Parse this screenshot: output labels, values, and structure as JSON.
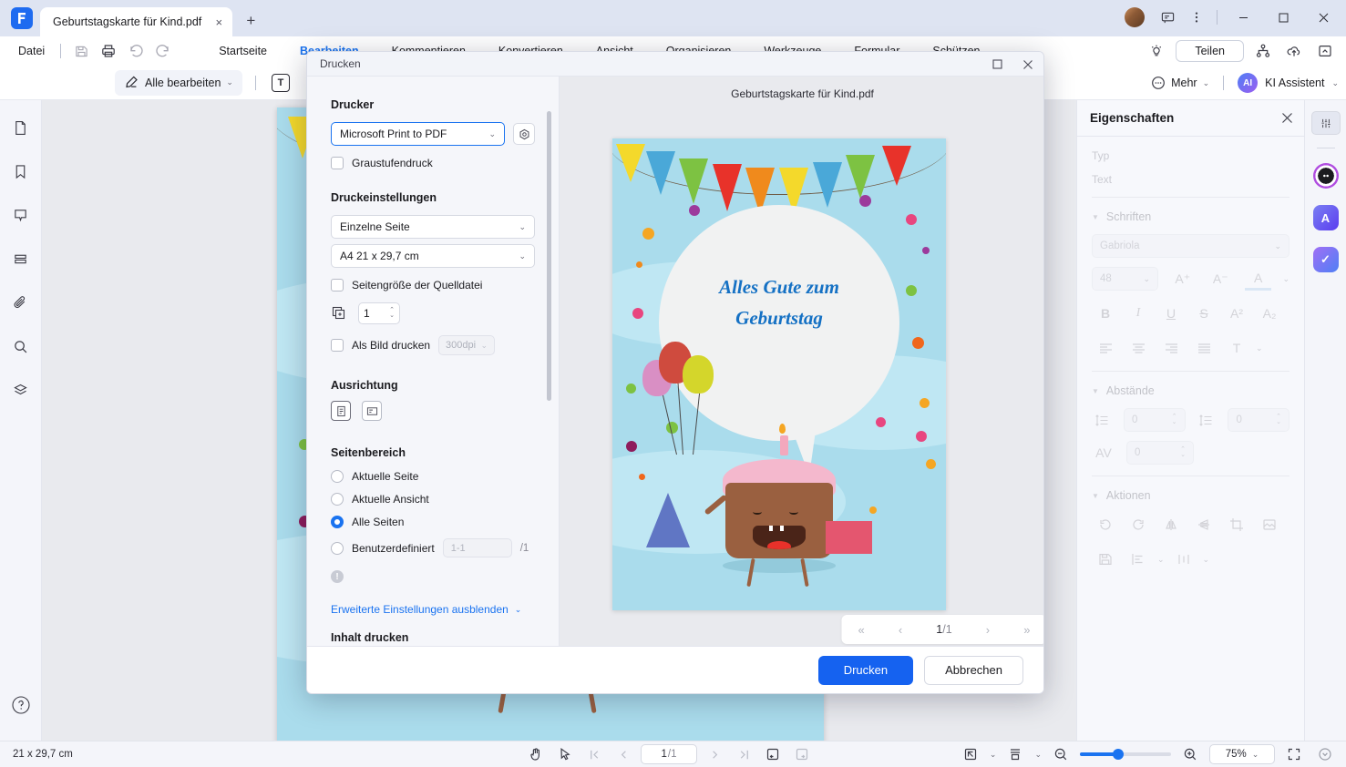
{
  "window": {
    "tab_title": "Geburtstagskarte für Kind.pdf",
    "close_tab": "×",
    "new_tab": "+",
    "minimize": "—",
    "maximize": "□",
    "close": "✕"
  },
  "menubar": {
    "file": "Datei",
    "tabs": [
      {
        "label": "Startseite",
        "active": false
      },
      {
        "label": "Bearbeiten",
        "active": true
      },
      {
        "label": "Kommentieren",
        "active": false
      },
      {
        "label": "Konvertieren",
        "active": false
      },
      {
        "label": "Ansicht",
        "active": false
      },
      {
        "label": "Organisieren",
        "active": false
      },
      {
        "label": "Werkzeuge",
        "active": false
      },
      {
        "label": "Formular",
        "active": false
      },
      {
        "label": "Schützen",
        "active": false
      }
    ],
    "share_label": "Teilen"
  },
  "toolbar": {
    "edit_all": "Alle bearbeiten",
    "text_tool": "T",
    "more": "Mehr",
    "ai_assistant": "KI Assistent",
    "ai_badge": "AI"
  },
  "left_rail": [
    {
      "name": "page-thumbnails-icon"
    },
    {
      "name": "bookmarks-icon"
    },
    {
      "name": "comments-icon"
    },
    {
      "name": "layers-list-icon"
    },
    {
      "name": "attachments-icon"
    },
    {
      "name": "search-icon"
    },
    {
      "name": "layers-icon"
    }
  ],
  "properties": {
    "title": "Eigenschaften",
    "type_label": "Typ",
    "type_value": "Text",
    "fonts_section": "Schriften",
    "font_family": "Gabriola",
    "font_size": "48",
    "spacing_section": "Abstände",
    "line_spacing": "0",
    "para_spacing": "0",
    "char_spacing": "0",
    "actions_section": "Aktionen"
  },
  "statusbar": {
    "page_size": "21 x 29,7 cm",
    "page_current": "1",
    "page_total": "/1",
    "zoom": "75%"
  },
  "dialog": {
    "title": "Drucken",
    "printer_section": "Drucker",
    "printer_value": "Microsoft Print to PDF",
    "grayscale_label": "Graustufendruck",
    "grayscale_checked": false,
    "settings_section": "Druckeinstellungen",
    "page_mode_value": "Einzelne Seite",
    "paper_size_value": "A4 21 x 29,7 cm",
    "source_size_label": "Seitengröße der Quelldatei",
    "source_size_checked": false,
    "copies_value": "1",
    "print_as_image_label": "Als Bild drucken",
    "print_as_image_checked": false,
    "dpi_value": "300dpi",
    "orientation_section": "Ausrichtung",
    "page_range_section": "Seitenbereich",
    "range_options": [
      {
        "label": "Aktuelle Seite",
        "selected": false
      },
      {
        "label": "Aktuelle Ansicht",
        "selected": false
      },
      {
        "label": "Alle Seiten",
        "selected": true
      },
      {
        "label": "Benutzerdefiniert",
        "selected": false
      }
    ],
    "custom_placeholder": "1-1",
    "custom_total": "/1",
    "advanced_link": "Erweiterte Einstellungen ausblenden",
    "content_section": "Inhalt drucken",
    "preview_title": "Geburtstagskarte für Kind.pdf",
    "preview_page_current": "1",
    "preview_page_total": "/1",
    "nav_first": "«",
    "nav_prev": "‹",
    "nav_next": "›",
    "nav_last": "»",
    "print_button": "Drucken",
    "cancel_button": "Abbrechen",
    "maximize": "□",
    "close": "✕"
  },
  "card": {
    "greeting_line1": "Alles Gute zum",
    "greeting_line2": "Geburtstag"
  },
  "colors": {
    "accent": "#1a73f0",
    "primary_button": "#1562f0",
    "card_background": "#aadcec",
    "card_text": "#1571c4",
    "titlebar": "#dee4f2"
  }
}
